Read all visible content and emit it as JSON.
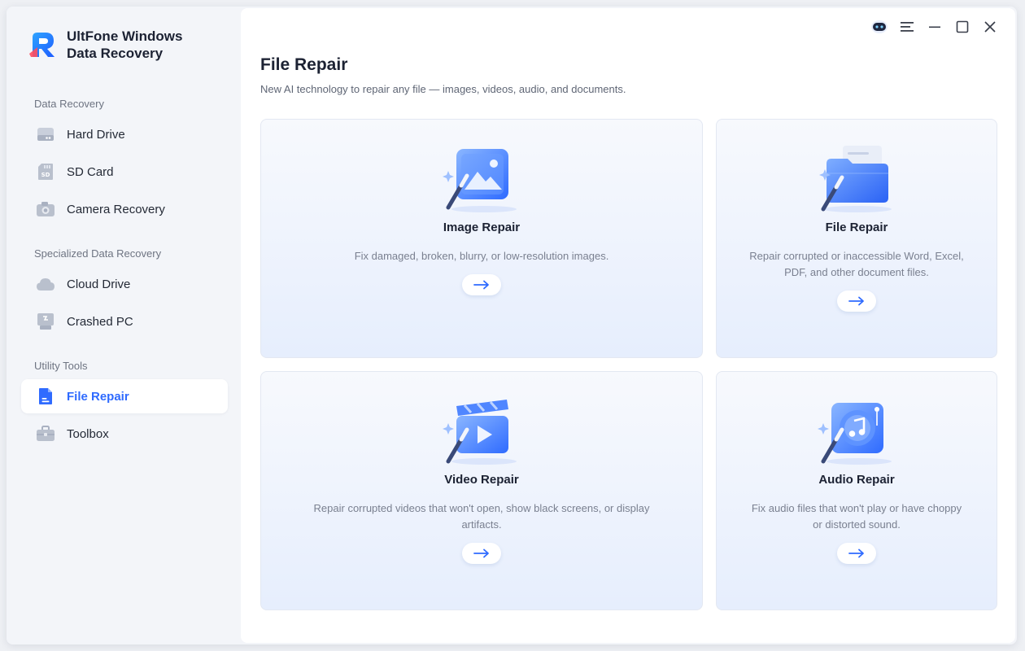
{
  "app": {
    "name": "UltFone Windows Data Recovery"
  },
  "sidebar": {
    "sections": [
      {
        "label": "Data Recovery",
        "items": [
          {
            "label": "Hard Drive",
            "icon": "hard-drive-icon"
          },
          {
            "label": "SD Card",
            "icon": "sd-card-icon"
          },
          {
            "label": "Camera Recovery",
            "icon": "camera-icon"
          }
        ]
      },
      {
        "label": "Specialized Data Recovery",
        "items": [
          {
            "label": "Cloud Drive",
            "icon": "cloud-icon"
          },
          {
            "label": "Crashed PC",
            "icon": "crashed-pc-icon"
          }
        ]
      },
      {
        "label": "Utility Tools",
        "items": [
          {
            "label": "File Repair",
            "icon": "file-icon",
            "active": true
          },
          {
            "label": "Toolbox",
            "icon": "toolbox-icon"
          }
        ]
      }
    ]
  },
  "header": {
    "controls": [
      "chatbot-icon",
      "menu-icon",
      "minimize-icon",
      "maximize-icon",
      "close-icon"
    ]
  },
  "main": {
    "title": "File Repair",
    "subtitle": "New AI technology to repair any file — images, videos, audio, and documents.",
    "cards": [
      {
        "title": "Image Repair",
        "description": "Fix damaged, broken, blurry, or low-resolution images.",
        "icon": "image-repair-icon"
      },
      {
        "title": "File Repair",
        "description": "Repair corrupted or inaccessible Word, Excel, PDF, and other document files.",
        "icon": "folder-repair-icon"
      },
      {
        "title": "Video Repair",
        "description": "Repair corrupted videos that won't open, show black screens, or display artifacts.",
        "icon": "video-repair-icon"
      },
      {
        "title": "Audio Repair",
        "description": "Fix audio files that won't play or have choppy or distorted sound.",
        "icon": "audio-repair-icon"
      }
    ]
  },
  "colors": {
    "accent": "#2f6bff",
    "sidebar_bg": "#f3f5f9",
    "card_gradient_end": "#e6eefd"
  }
}
